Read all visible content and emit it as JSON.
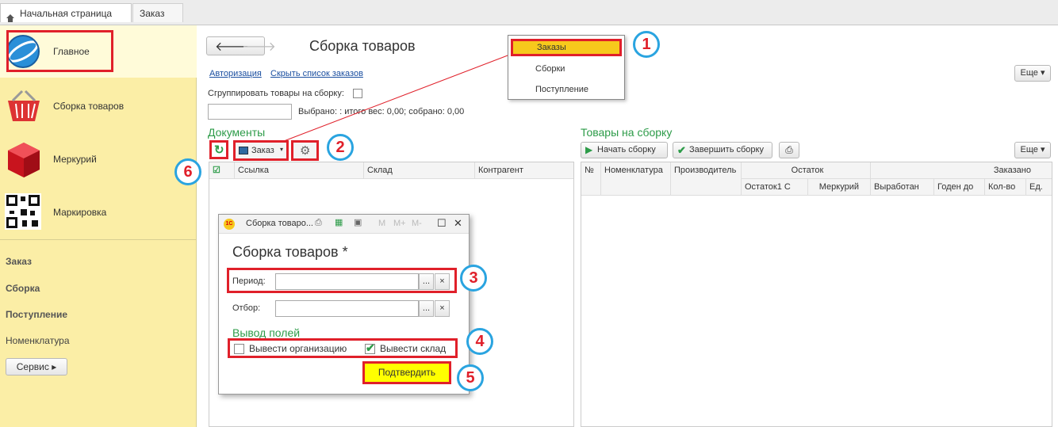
{
  "tabs": [
    {
      "label": "Начальная страница"
    },
    {
      "label": "Заказ"
    }
  ],
  "sidebar": {
    "sections": [
      {
        "label": "Главное",
        "icon": "globe-icon"
      },
      {
        "label": "Сборка товаров",
        "icon": "basket-icon"
      },
      {
        "label": "Меркурий",
        "icon": "cube-icon"
      },
      {
        "label": "Маркировка",
        "icon": "qr-code-icon"
      }
    ],
    "links": [
      "Заказ",
      "Сборка",
      "Поступление",
      "Номенклатура"
    ],
    "service_button": "Сервис"
  },
  "form": {
    "title": "Сборка товаров",
    "links": [
      "Авторизация",
      "Скрыть список  заказов"
    ],
    "group_label": "Сгруппировать товары на сборку:",
    "selected_text": "Выбрано:  : итого вес: 0,00; собрано: 0,00",
    "more_button": "Еще"
  },
  "popup_menu": {
    "items": [
      "Заказы",
      "Сборки",
      "Поступление"
    ]
  },
  "documents": {
    "title": "Документы",
    "order_button": "Заказ",
    "columns": [
      "Ссылка",
      "Склад",
      "Контрагент"
    ]
  },
  "goods": {
    "title": "Товары на сборку",
    "start_button": "Начать  сборку",
    "finish_button": "Завершить  сборку",
    "more_button": "Еще",
    "columns": {
      "num": "№",
      "nomenclature": "Номенклатура",
      "manufacturer": "Производитель",
      "stock": "Остаток",
      "ordered": "Заказано"
    },
    "subcolumns": [
      "Остаток1 С",
      "Меркурий",
      "Выработан",
      "Годен до",
      "Кол-во",
      "Ед."
    ]
  },
  "dialog": {
    "window_title": "Сборка товаро...",
    "heading": "Сборка товаров *",
    "period_label": "Период:",
    "filter_label": "Отбор:",
    "dots": "...",
    "clear": "×",
    "fields_section": "Вывод полей",
    "org_checkbox": "Вывести организацию",
    "warehouse_checkbox": "Вывести склад",
    "confirm_button": "Подтвердить",
    "toolbar_letters": [
      "M",
      "M+",
      "M-"
    ]
  },
  "callouts": [
    "1",
    "2",
    "3",
    "4",
    "5",
    "6"
  ],
  "colors": {
    "sidebar_bg": "#fbeea6",
    "accent_red": "#e0202a",
    "callout_blue": "#2aa4e0",
    "heading_green": "#2c9b48",
    "confirm_yellow": "#ffff00"
  }
}
